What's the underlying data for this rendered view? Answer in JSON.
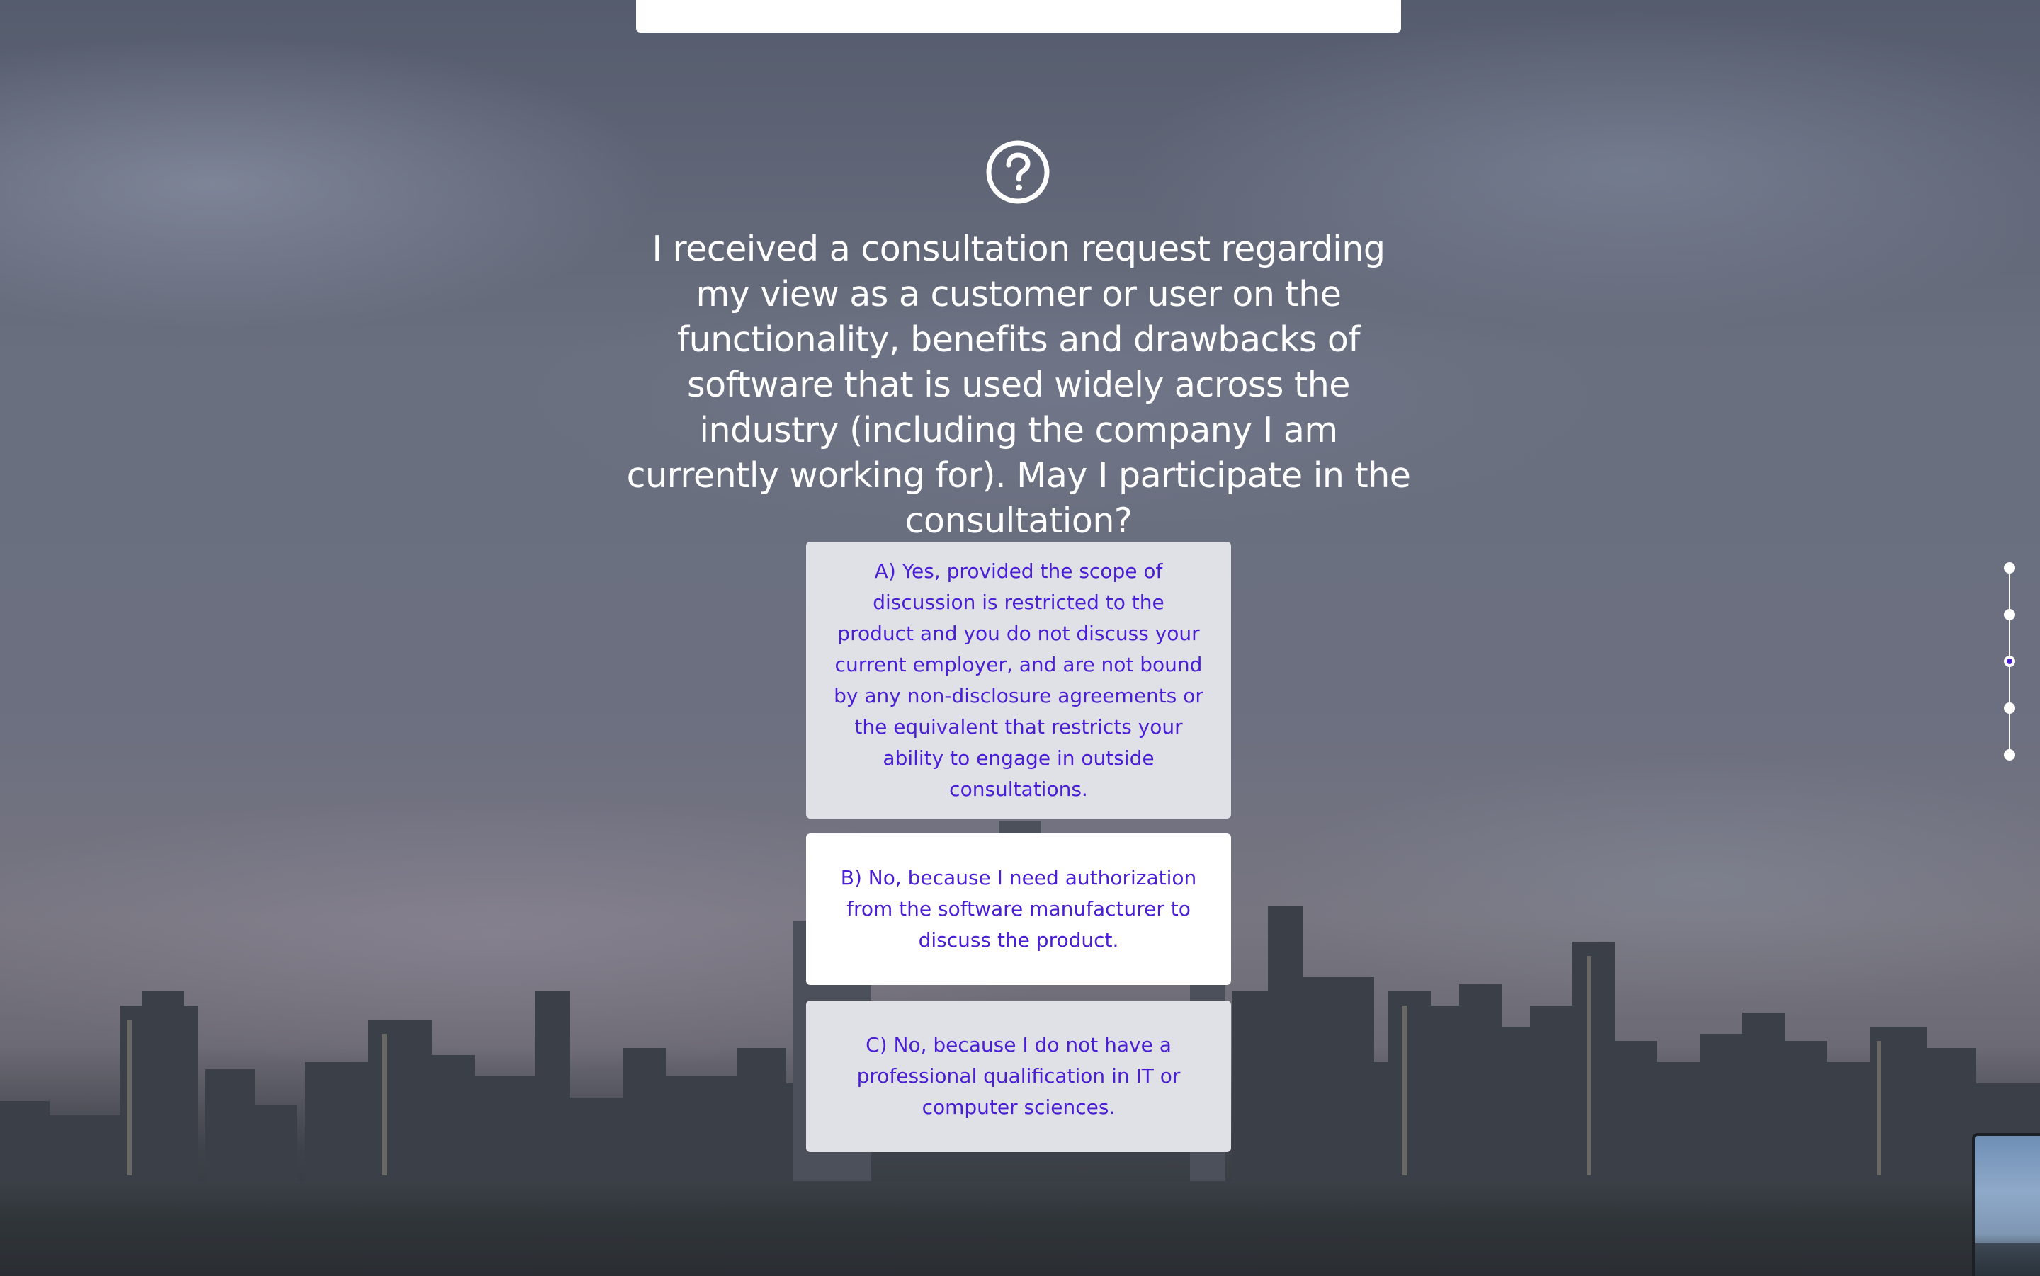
{
  "question": {
    "icon": "question-circle-icon",
    "text": "I received a consultation request regarding my view as a customer or user on the functionality, benefits and drawbacks of software that is used widely across the industry (including the company I am currently working for). May I participate in the consultation?"
  },
  "options": [
    {
      "label": "A) Yes, provided the scope of discussion is restricted to the product and you do not discuss your current employer, and are not bound by any non-disclosure agreements or the equivalent that restricts your ability to engage in outside consultations."
    },
    {
      "label": "B) No, because I need authorization from the software manufacturer to discuss the product."
    },
    {
      "label": "C) No, because I do not have a professional qualification in IT or computer sciences."
    }
  ],
  "progress": {
    "total_steps": 5,
    "current_step": 3
  },
  "colors": {
    "accent": "#4a1ed4",
    "option_background": "#dfe1e6",
    "option_hover_background": "#ffffff",
    "text_on_background": "#ffffff"
  }
}
